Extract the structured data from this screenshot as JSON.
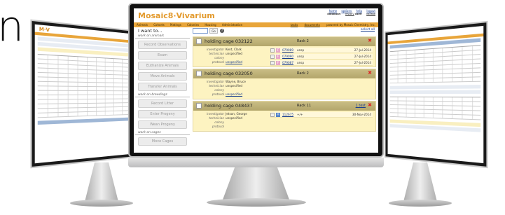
{
  "heading_fragment": "n",
  "app": {
    "logo_part1": "Mosaic",
    "logo_sep": "8",
    "logo_part2": "·Vivarium",
    "top_links": [
      "home",
      "options",
      "help",
      "logout"
    ],
    "db_label": "database:",
    "db_value": "MVDEV",
    "user_label": "user:",
    "user_value": "nanasti",
    "menu": [
      "Animals",
      "Cohorts",
      "Matings",
      "Colonies",
      "Housing",
      "Administration"
    ],
    "menu_right": [
      "tasks",
      "documents"
    ],
    "powered_by": "powered by Mosaic Chemistry, Inc."
  },
  "left_panel": {
    "title": "I want to...",
    "sections": [
      {
        "label": "work on animals",
        "buttons": [
          "Record Observations",
          "Exam",
          "Euthanize Animals",
          "Move Animals",
          "Transfer Animals"
        ]
      },
      {
        "label": "work on breedings",
        "buttons": [
          "Record Litter",
          "Enter Progeny",
          "Wean Progeny"
        ]
      },
      {
        "label": "work on cages",
        "buttons": [
          "Move Cages"
        ]
      }
    ]
  },
  "search": {
    "go_label": "Go",
    "help": "?",
    "select_all": "select all"
  },
  "cages": [
    {
      "title": "holding cage 032122",
      "rack": "Rack 2",
      "investigator": "Kent, Clark",
      "technician": "unspecified",
      "colony": "",
      "protocol": "unspecified",
      "animals": [
        {
          "sex": "F",
          "id": "079089",
          "genotype": "unsp",
          "date": "27-Jul-2014"
        },
        {
          "sex": "F",
          "id": "079090",
          "genotype": "unsp",
          "date": "27-Jul-2014"
        },
        {
          "sex": "F",
          "id": "079087",
          "genotype": "unsp",
          "date": "27-Jul-2014"
        }
      ]
    },
    {
      "title": "holding cage 032050",
      "rack": "Rack 2",
      "investigator": "Wayne, Bruce",
      "technician": "unspecified",
      "colony": "",
      "protocol": "unspecified",
      "animals": []
    },
    {
      "title": "holding cage 048437",
      "rack": "Rack 11",
      "test_link": "1 test",
      "investigator": "Jetson, George",
      "technician": "unspecified",
      "colony": "",
      "protocol": "",
      "animals": [
        {
          "sex": "M",
          "id": "112675",
          "genotype": "+/+",
          "date": "30-Nov-2014"
        }
      ]
    }
  ],
  "labels": {
    "investigator": "investigator",
    "technician": "technician",
    "colony": "colony",
    "protocol": "protocol"
  }
}
